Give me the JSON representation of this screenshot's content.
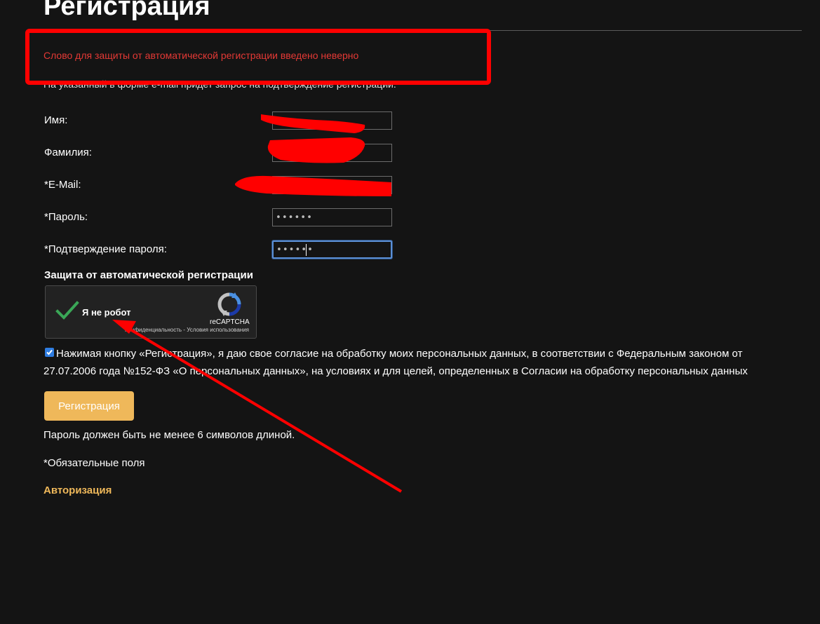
{
  "page": {
    "title": "Регистрация"
  },
  "error": {
    "message": "Слово для защиты от автоматической регистрации введено неверно"
  },
  "hint": {
    "text": "На указанный в форме e-mail придет запрос на подтверждение регистрации."
  },
  "form": {
    "first_name": {
      "label": "Имя:",
      "value": ""
    },
    "last_name": {
      "label": "Фамилия:",
      "value": ""
    },
    "email": {
      "label": "*E-Mail:",
      "value": ""
    },
    "password": {
      "label": "*Пароль:",
      "value": "••••••"
    },
    "password_confirm": {
      "label": "*Подтверждение пароля:",
      "value": "••••••"
    }
  },
  "captcha": {
    "heading": "Защита от автоматической регистрации",
    "label": "Я не робот",
    "brand": "reCAPTCHA",
    "links": "Конфиденциальность - Условия использования",
    "checked": true,
    "colors": {
      "check": "#3aa757",
      "logo_blue": "#4a90e2",
      "logo_gray": "#c1c1c1"
    }
  },
  "consent": {
    "checked": true,
    "text": "Нажимая кнопку «Регистрация», я даю свое согласие на обработку моих персональных данных, в соответствии с Федеральным законом от 27.07.2006 года №152-ФЗ «О персональных данных», на условиях и для целей, определенных в Согласии на обработку персональных данных"
  },
  "buttons": {
    "register": "Регистрация"
  },
  "notes": {
    "password_length": "Пароль должен быть не менее 6 символов длиной.",
    "required_fields": "*Обязательные поля"
  },
  "links": {
    "authorization": "Авторизация"
  },
  "colors": {
    "background": "#141414",
    "accent": "#efb85a",
    "error": "#e53935",
    "annotation": "#ff0000",
    "focus": "#5b8fd6"
  }
}
